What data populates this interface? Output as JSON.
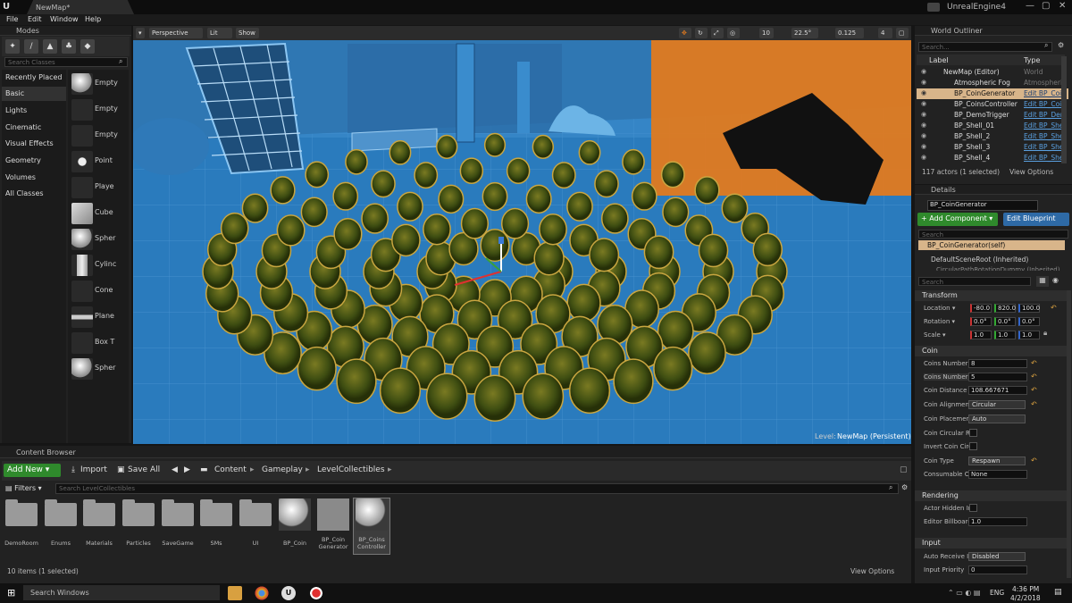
{
  "titlebar": {
    "map_tab": "NewMap*",
    "app_name": "UnrealEngine4",
    "minimize": "—",
    "maximize": "▢",
    "close": "✕"
  },
  "menu": [
    "File",
    "Edit",
    "Window",
    "Help"
  ],
  "modes": {
    "tab": "Modes",
    "search_placeholder": "Search Classes",
    "categories": [
      "Recently Placed",
      "Basic",
      "Lights",
      "Cinematic",
      "Visual Effects",
      "Geometry",
      "Volumes",
      "All Classes"
    ],
    "selected_category": "Basic",
    "items": [
      "Empty",
      "Empty",
      "Empty",
      "Point",
      "Playe",
      "Cube",
      "Spher",
      "Cylinc",
      "Cone",
      "Plane",
      "Box T",
      "Spher"
    ]
  },
  "viewport": {
    "perspective": "Perspective",
    "lit": "Lit",
    "show": "Show",
    "grid_value": "10",
    "rotation_value": "22.5°",
    "scale_value": "0.125",
    "cam_value": "4",
    "level_label": "Level:",
    "level_name": "NewMap (Persistent)"
  },
  "outliner": {
    "tab": "World Outliner",
    "search_placeholder": "Search...",
    "col_label": "Label",
    "col_type": "Type",
    "rows": [
      {
        "label": "NewMap (Editor)",
        "type": "World",
        "link": false
      },
      {
        "label": "Atmospheric Fog",
        "type": "Atmospheric",
        "link": false
      },
      {
        "label": "BP_CoinGenerator",
        "type": "Edit BP_Coi",
        "link": true
      },
      {
        "label": "BP_CoinsController",
        "type": "Edit BP_Coi",
        "link": true
      },
      {
        "label": "BP_DemoTrigger",
        "type": "Edit BP_Dem",
        "link": true
      },
      {
        "label": "BP_Shell_01",
        "type": "Edit BP_She",
        "link": true
      },
      {
        "label": "BP_Shell_2",
        "type": "Edit BP_She",
        "link": true
      },
      {
        "label": "BP_Shell_3",
        "type": "Edit BP_She",
        "link": true
      },
      {
        "label": "BP_Shell_4",
        "type": "Edit BP_She",
        "link": true
      }
    ],
    "status": "117 actors (1 selected)",
    "view_options": "View Options"
  },
  "details": {
    "tab": "Details",
    "object_name": "BP_CoinGenerator",
    "add_component": "+ Add Component ▾",
    "edit_blueprint": "Edit Blueprint",
    "search_placeholder": "Search",
    "components": [
      "BP_CoinGenerator(self)",
      "DefaultSceneRoot (Inherited)",
      "CircularPathRotationDummy (Inherited)"
    ],
    "transform": {
      "title": "Transform",
      "location_label": "Location ▾",
      "location": [
        "-80.0",
        "820.0",
        "100.0"
      ],
      "rotation_label": "Rotation ▾",
      "rotation": [
        "0.0°",
        "0.0°",
        "0.0°"
      ],
      "scale_label": "Scale ▾",
      "scale": [
        "1.0",
        "1.0",
        "1.0"
      ]
    },
    "coin": {
      "title": "Coin",
      "props": [
        {
          "label": "Coins Number",
          "value": "8",
          "kind": "field"
        },
        {
          "label": "Coins Number",
          "value": "5",
          "kind": "field"
        },
        {
          "label": "Coin Distance",
          "value": "108.667671",
          "kind": "field"
        },
        {
          "label": "Coin Alignment",
          "value": "Circular",
          "kind": "dd"
        },
        {
          "label": "Coin Placemen",
          "value": "Auto",
          "kind": "dd"
        },
        {
          "label": "Coin Circular R",
          "value": "",
          "kind": "chk"
        },
        {
          "label": "Invert Coin Circ",
          "value": "",
          "kind": "chk"
        },
        {
          "label": "Coin Type",
          "value": "Respawn",
          "kind": "dd"
        },
        {
          "label": "Consumable Cl",
          "value": "None",
          "kind": "field"
        }
      ]
    },
    "rendering": {
      "title": "Rendering",
      "props": [
        {
          "label": "Actor Hidden In",
          "value": "",
          "kind": "chk"
        },
        {
          "label": "Editor Billboard",
          "value": "1.0",
          "kind": "field"
        }
      ]
    },
    "input": {
      "title": "Input",
      "props": [
        {
          "label": "Auto Receive In",
          "value": "Disabled",
          "kind": "dd"
        },
        {
          "label": "Input Priority",
          "value": "0",
          "kind": "field"
        }
      ]
    }
  },
  "content_browser": {
    "tab": "Content Browser",
    "add_new": "Add New ▾",
    "import": "Import",
    "save_all": "Save All",
    "path": [
      "Content",
      "Gameplay",
      "LevelCollectibles"
    ],
    "filters": "Filters ▾",
    "search_placeholder": "Search LevelCollectibles",
    "assets": [
      {
        "name": "DemoRoom",
        "kind": "folder"
      },
      {
        "name": "Enums",
        "kind": "folder"
      },
      {
        "name": "Materials",
        "kind": "folder"
      },
      {
        "name": "Particles",
        "kind": "folder"
      },
      {
        "name": "SaveGame",
        "kind": "folder"
      },
      {
        "name": "SMs",
        "kind": "folder"
      },
      {
        "name": "UI",
        "kind": "folder"
      },
      {
        "name": "BP_Coin",
        "kind": "sphere"
      },
      {
        "name": "BP_Coin Generator",
        "kind": "gen"
      },
      {
        "name": "BP_Coins Controller",
        "kind": "sphere"
      }
    ],
    "status": "10 items (1 selected)",
    "view_options": "View Options"
  },
  "taskbar": {
    "search": "Search Windows",
    "lang": "ENG",
    "time": "4:36 PM",
    "date": "4/2/2018"
  },
  "colors": {
    "green": "#2f8a2c",
    "blue": "#2e6aa6",
    "orange": "#e07a1f",
    "selection": "#d8b58a"
  }
}
